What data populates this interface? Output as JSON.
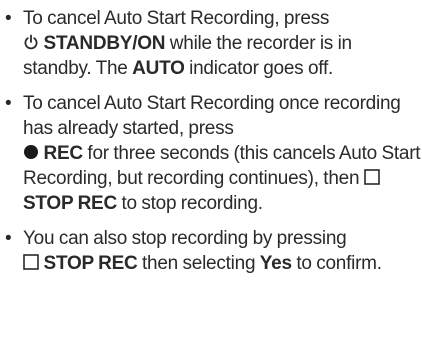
{
  "bullet_symbol": "•",
  "items": [
    {
      "t1": "To cancel Auto Start Recording, press",
      "icon1": "power-icon",
      "b1": "STANDBY/ON",
      "t2": " while the recorder is in standby. The ",
      "b2": "AUTO",
      "t3": " indicator goes off."
    },
    {
      "t1": "To cancel Auto Start Recording once recording has already started, press",
      "icon1": "record-icon",
      "b1": "REC",
      "t2": " for three seconds (this cancels Auto Start Recording, but recording continues), then ",
      "icon2": "stop-icon",
      "b2": "STOP REC",
      "t3": " to stop recording."
    },
    {
      "t1": "You can also stop recording by pressing",
      "icon1": "stop-icon",
      "b1": "STOP REC",
      "t2": " then selecting ",
      "b2": "Yes",
      "t3": " to confirm."
    }
  ]
}
